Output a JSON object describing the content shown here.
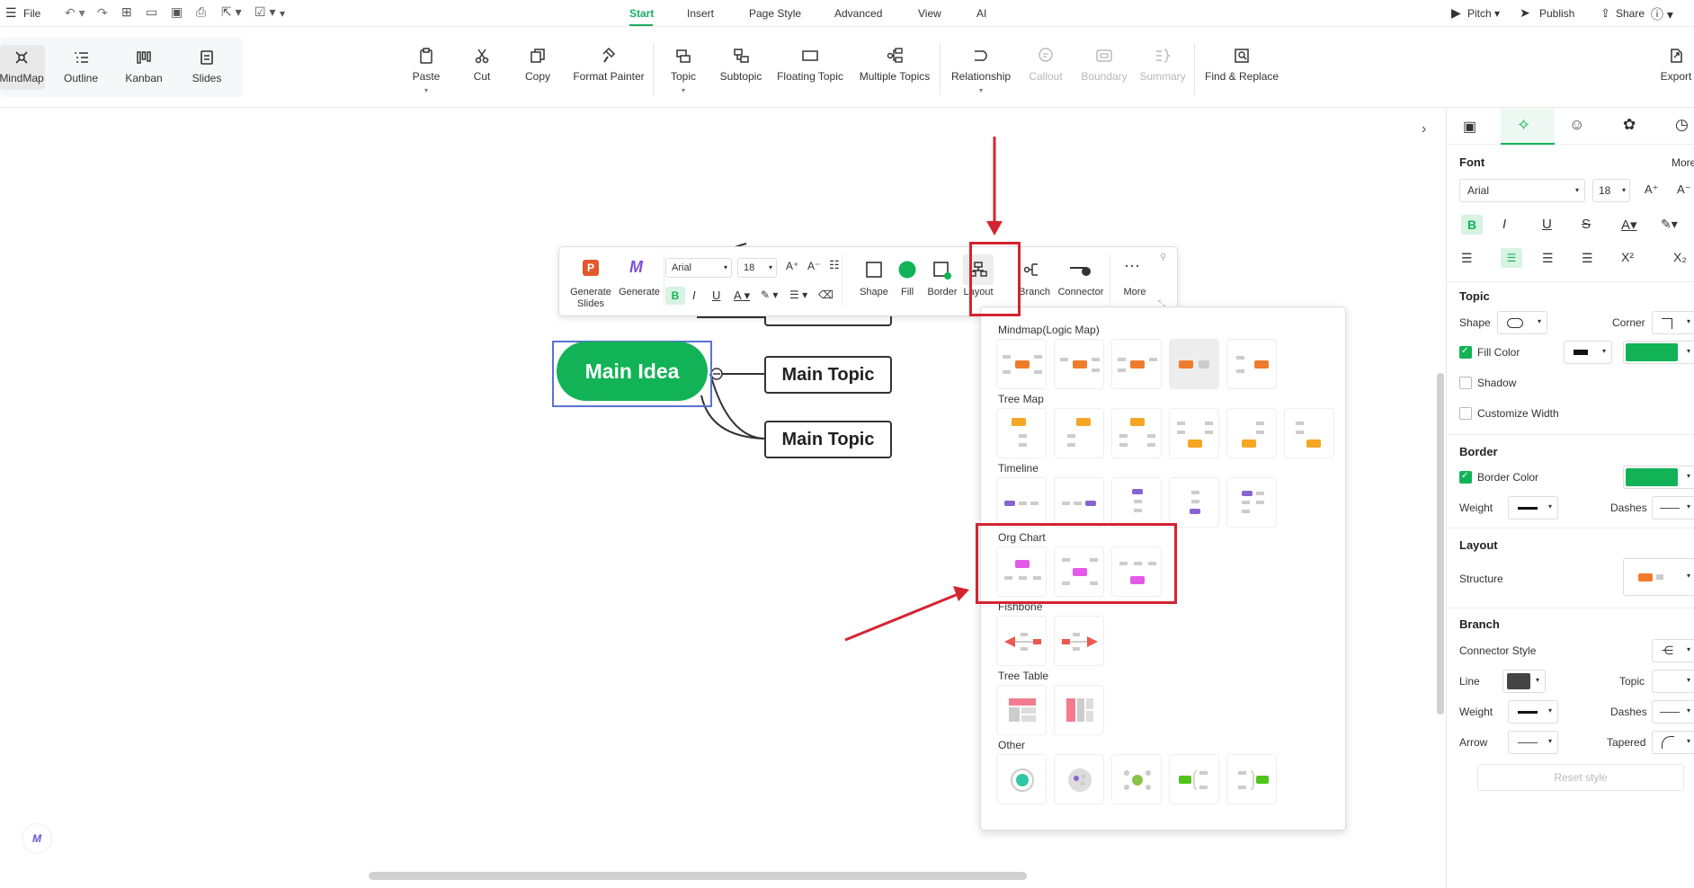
{
  "menubar": {
    "file": "File",
    "tabs": [
      "Start",
      "Insert",
      "Page Style",
      "Advanced",
      "View",
      "AI"
    ],
    "active_tab": "Start",
    "pitch": "Pitch",
    "publish": "Publish",
    "share": "Share"
  },
  "views": [
    "MindMap",
    "Outline",
    "Kanban",
    "Slides"
  ],
  "ribbon": {
    "paste": "Paste",
    "cut": "Cut",
    "copy": "Copy",
    "format_painter": "Format Painter",
    "topic": "Topic",
    "subtopic": "Subtopic",
    "floating_topic": "Floating Topic",
    "multiple_topics": "Multiple Topics",
    "relationship": "Relationship",
    "callout": "Callout",
    "boundary": "Boundary",
    "summary": "Summary",
    "find_replace": "Find & Replace",
    "export": "Export"
  },
  "canvas": {
    "main_idea": "Main Idea",
    "topics": [
      "Main Topic",
      "Main Topic"
    ]
  },
  "floating_toolbar": {
    "generate_slides_1": "Generate",
    "generate_slides_2": "Slides",
    "generate": "Generate",
    "font": "Arial",
    "size": "18",
    "shape": "Shape",
    "fill": "Fill",
    "border": "Border",
    "layout": "Layout",
    "branch": "Branch",
    "connector": "Connector",
    "more": "More"
  },
  "layout_panel": {
    "sections": [
      "Mindmap(Logic Map)",
      "Tree Map",
      "Timeline",
      "Org Chart",
      "Fishbone",
      "Tree Table",
      "Other"
    ]
  },
  "right_panel": {
    "font_head": "Font",
    "more": "More",
    "font": "Arial",
    "size": "18",
    "topic_head": "Topic",
    "shape": "Shape",
    "corner": "Corner",
    "fill_color": "Fill Color",
    "shadow": "Shadow",
    "customize_width": "Customize Width",
    "border_head": "Border",
    "border_color": "Border Color",
    "weight": "Weight",
    "dashes": "Dashes",
    "layout_head": "Layout",
    "structure": "Structure",
    "branch_head": "Branch",
    "connector_style": "Connector Style",
    "line": "Line",
    "topic": "Topic",
    "weight2": "Weight",
    "dashes2": "Dashes",
    "arrow": "Arrow",
    "tapered": "Tapered",
    "reset": "Reset style"
  },
  "colors": {
    "accent": "#12b356",
    "highlight": "#d42430",
    "selection": "#5b72d6"
  }
}
